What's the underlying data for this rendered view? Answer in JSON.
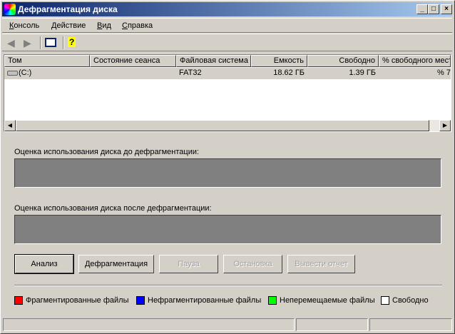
{
  "window": {
    "title": "Дефрагментация диска",
    "min": "_",
    "max": "□",
    "close": "×"
  },
  "menu": [
    "Консоль",
    "Действие",
    "Вид",
    "Справка"
  ],
  "list": {
    "columns": [
      "Том",
      "Состояние сеанса",
      "Файловая система",
      "Емкость",
      "Свободно",
      "% свободного места"
    ],
    "rows": [
      {
        "volume": "(C:)",
        "state": "",
        "fs": "FAT32",
        "capacity": "18.62 ГБ",
        "free": "1.39 ГБ",
        "pct": "7 %"
      }
    ]
  },
  "before_label": "Оценка использования диска до дефрагментации:",
  "after_label": "Оценка использования диска после дефрагментации:",
  "buttons": [
    "Анализ",
    "Дефрагментация",
    "Пауза",
    "Остановка",
    "Вывести отчет"
  ],
  "legend": [
    {
      "label": "Фрагментированные файлы",
      "color": "#ff0000"
    },
    {
      "label": "Нефрагментированные файлы",
      "color": "#0000ff"
    },
    {
      "label": "Неперемещаемые файлы",
      "color": "#00ff00"
    },
    {
      "label": "Свободно",
      "color": "#ffffff"
    }
  ]
}
